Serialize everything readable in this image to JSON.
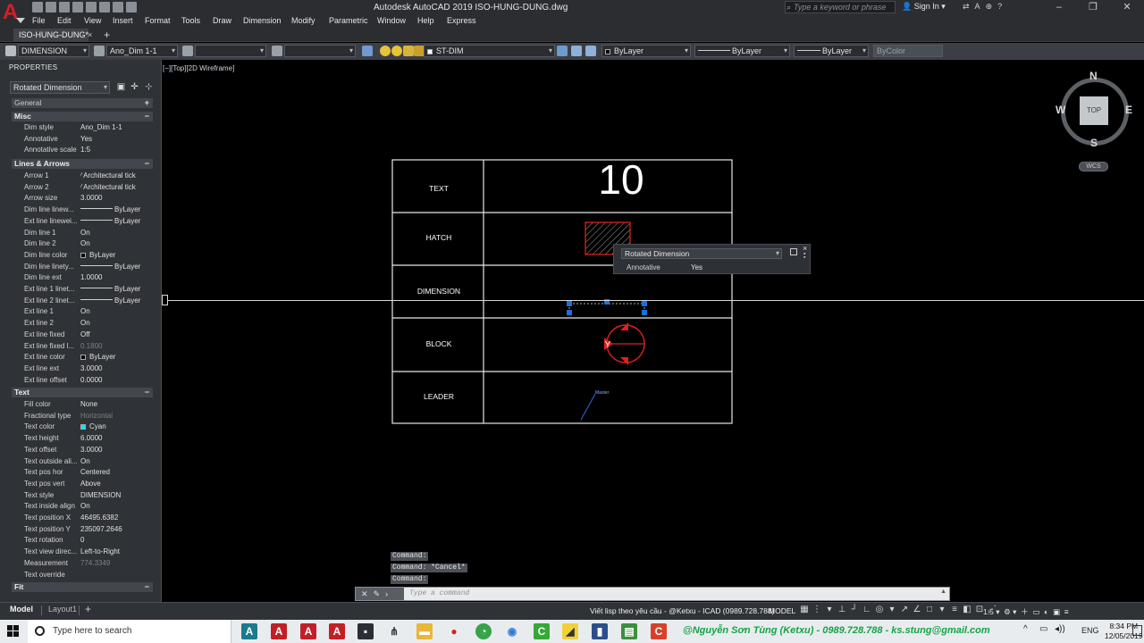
{
  "window": {
    "title": "Autodesk AutoCAD 2019   ISO-HUNG-DUNG.dwg",
    "search_placeholder": "Type a keyword or phrase",
    "sign_in": "Sign In"
  },
  "menu": [
    "File",
    "Edit",
    "View",
    "Insert",
    "Format",
    "Tools",
    "Draw",
    "Dimension",
    "Modify",
    "Parametric",
    "Window",
    "Help",
    "Express"
  ],
  "doc_tab": {
    "label": "ISO-HUNG-DUNG*",
    "close": "×",
    "add": "+"
  },
  "toolbar": {
    "dim_style_family": "DIMENSION",
    "dim_style": "Ano_Dim 1-1",
    "layer": "ST-DIM",
    "color": "ByLayer",
    "linetype": "ByLayer",
    "lineweight": "ByLayer",
    "plotstyle": "ByColor"
  },
  "properties": {
    "title": "PROPERTIES",
    "object_type": "Rotated Dimension",
    "sections": {
      "general": "General",
      "misc": "Misc",
      "lines_arrows": "Lines & Arrows",
      "text": "Text",
      "fit": "Fit"
    },
    "toggle_expanded": "−",
    "toggle_collapsed": "+",
    "misc": [
      {
        "label": "Dim style",
        "value": "Ano_Dim 1-1"
      },
      {
        "label": "Annotative",
        "value": "Yes"
      },
      {
        "label": "Annotative scale",
        "value": "1:5"
      }
    ],
    "lines": [
      {
        "label": "Arrow 1",
        "value": "Architectural tick"
      },
      {
        "label": "Arrow 2",
        "value": "Architectural tick"
      },
      {
        "label": "Arrow size",
        "value": "3.0000"
      },
      {
        "label": "Dim line linew...",
        "value": "ByLayer"
      },
      {
        "label": "Ext line linewei...",
        "value": "ByLayer"
      },
      {
        "label": "Dim line 1",
        "value": "On"
      },
      {
        "label": "Dim line 2",
        "value": "On"
      },
      {
        "label": "Dim line color",
        "value": "ByLayer"
      },
      {
        "label": "Dim line linety...",
        "value": "ByLayer"
      },
      {
        "label": "Dim line ext",
        "value": "1.0000"
      },
      {
        "label": "Ext line 1 linet...",
        "value": "ByLayer"
      },
      {
        "label": "Ext line 2 linet...",
        "value": "ByLayer"
      },
      {
        "label": "Ext line 1",
        "value": "On"
      },
      {
        "label": "Ext line 2",
        "value": "On"
      },
      {
        "label": "Ext line fixed",
        "value": "Off"
      },
      {
        "label": "Ext line fixed l...",
        "value": "0.1800"
      },
      {
        "label": "Ext line color",
        "value": "ByLayer"
      },
      {
        "label": "Ext line ext",
        "value": "3.0000"
      },
      {
        "label": "Ext line offset",
        "value": "0.0000"
      }
    ],
    "text": [
      {
        "label": "Fill color",
        "value": "None"
      },
      {
        "label": "Fractional type",
        "value": "Horizontal"
      },
      {
        "label": "Text color",
        "value": "Cyan"
      },
      {
        "label": "Text height",
        "value": "6.0000"
      },
      {
        "label": "Text offset",
        "value": "3.0000"
      },
      {
        "label": "Text outside ali...",
        "value": "On"
      },
      {
        "label": "Text pos hor",
        "value": "Centered"
      },
      {
        "label": "Text pos vert",
        "value": "Above"
      },
      {
        "label": "Text style",
        "value": "DIMENSION"
      },
      {
        "label": "Text inside align",
        "value": "On"
      },
      {
        "label": "Text position X",
        "value": "46495.6382"
      },
      {
        "label": "Text position Y",
        "value": "235097.2646"
      },
      {
        "label": "Text rotation",
        "value": "0"
      },
      {
        "label": "Text view direc...",
        "value": "Left-to-Right"
      },
      {
        "label": "Measurement",
        "value": "774.3349"
      },
      {
        "label": "Text override",
        "value": ""
      }
    ]
  },
  "viewport": {
    "label": "[−][Top][2D Wireframe]"
  },
  "drawing": {
    "rows": [
      "TEXT",
      "HATCH",
      "DIMENSION",
      "BLOCK",
      "LEADER"
    ],
    "big_text": "10",
    "block_letter": "Y",
    "leader_text": "Master"
  },
  "quick_props": {
    "type": "Rotated Dimension",
    "label": "Annotative",
    "value": "Yes"
  },
  "viewcube": {
    "top": "TOP",
    "n": "N",
    "s": "S",
    "e": "E",
    "w": "W",
    "wcs": "WCS"
  },
  "command": {
    "history": [
      "Command:",
      "Command: *Cancel*",
      "Command:"
    ],
    "placeholder": "Type a command"
  },
  "layout_tabs": {
    "model": "Model",
    "layout1": "Layout1",
    "add": "+"
  },
  "status": {
    "promo": "Viết lisp theo yêu cầu - @Ketxu - ICAD (0989.728.788)",
    "model": "MODEL",
    "scale": "1:5"
  },
  "taskbar": {
    "search": "Type here to search",
    "credit": "@Nguyễn Sơn Tùng (Ketxu) - 0989.728.788 - ks.stung@gmail.com",
    "lang": "ENG",
    "time": "8:34 PM",
    "date": "12/05/2019"
  },
  "colors": {
    "accent_red": "#d12027",
    "grip_blue": "#1e6fd9",
    "credit_green": "#15a347"
  }
}
